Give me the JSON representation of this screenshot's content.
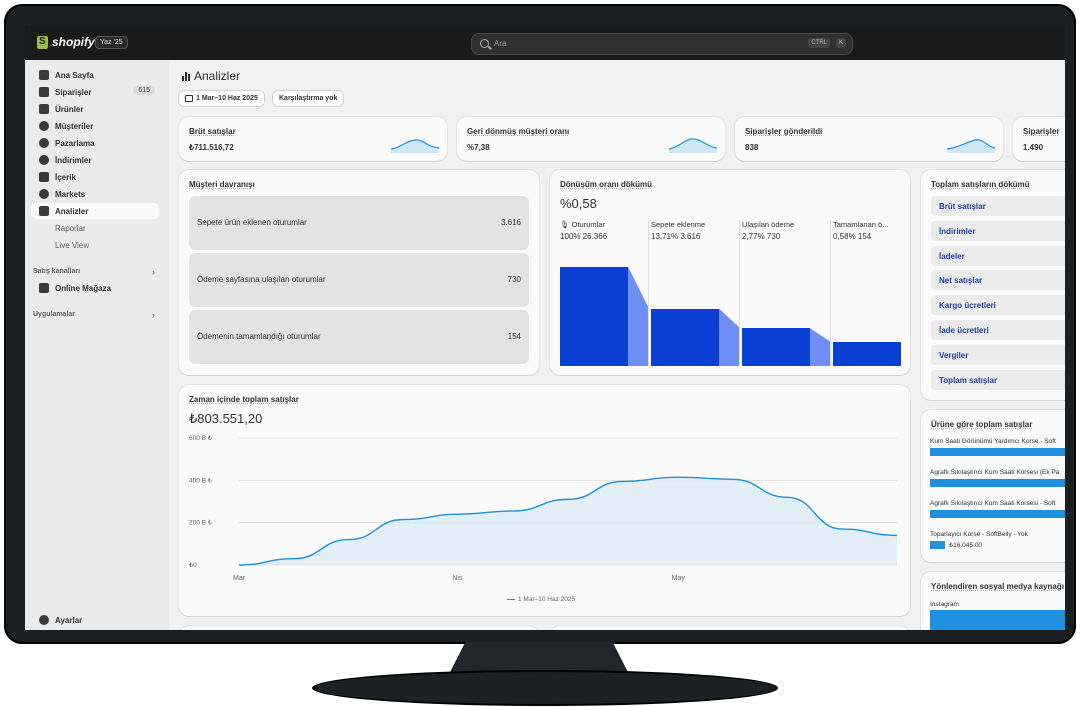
{
  "app": {
    "brand": "shopify",
    "edition_badge": "Yaz '25"
  },
  "search": {
    "placeholder": "Ara",
    "shortcut_ctrl": "CTRL",
    "shortcut_key": "K"
  },
  "sidebar": {
    "items": [
      {
        "label": "Ana Sayfa",
        "icon": "home-icon"
      },
      {
        "label": "Siparişler",
        "icon": "orders-icon",
        "count": "615"
      },
      {
        "label": "Ürünler",
        "icon": "tag-icon"
      },
      {
        "label": "Müşteriler",
        "icon": "person-icon"
      },
      {
        "label": "Pazarlama",
        "icon": "target-icon"
      },
      {
        "label": "İndirimler",
        "icon": "discount-icon"
      },
      {
        "label": "İçerik",
        "icon": "content-icon"
      },
      {
        "label": "Markets",
        "icon": "globe-icon"
      },
      {
        "label": "Analizler",
        "icon": "analytics-icon"
      }
    ],
    "subitems": [
      "Raporlar",
      "Live View"
    ],
    "sales_channels_heading": "Satış kanalları",
    "online_store": "Online Mağaza",
    "apps_heading": "Uygulamalar",
    "settings": "Ayarlar"
  },
  "page": {
    "title": "Analizler",
    "date_range": "1 Mar–10 Haz 2025",
    "comparison": "Karşılaştırma yok"
  },
  "metrics": [
    {
      "title": "Brüt satışlar",
      "value": "₺711.516,72"
    },
    {
      "title": "Geri dönmüş müşteri oranı",
      "value": "%7,38"
    },
    {
      "title": "Siparişler gönderildi",
      "value": "838"
    },
    {
      "title": "Siparişler",
      "value": "1.490"
    }
  ],
  "customer_behavior": {
    "title": "Müşteri davranışı",
    "rows": [
      {
        "label": "Sepete ürün eklenen oturumlar",
        "value": "3.616"
      },
      {
        "label": "Ödeme sayfasına ulaşılan oturumlar",
        "value": "730"
      },
      {
        "label": "Ödemenin tamamlandığı oturumlar",
        "value": "154"
      }
    ]
  },
  "conversion": {
    "title": "Dönüşüm oranı dökümü",
    "value": "%0,58",
    "steps": [
      {
        "label": "Oturumlar",
        "pct": "100%",
        "count": "26.366",
        "level": 0.71
      },
      {
        "label": "Sepete eklenme",
        "pct": "13,71%",
        "count": "3.616",
        "level": 0.41
      },
      {
        "label": "Ulaşılan ödeme",
        "pct": "2,77%",
        "count": "730",
        "level": 0.27
      },
      {
        "label": "Tamamlanan ö...",
        "pct": "0,58%",
        "count": "154",
        "level": 0.17
      }
    ]
  },
  "sales_breakdown": {
    "title": "Toplam satışların dökümü",
    "items": [
      "Brüt satışlar",
      "İndirimler",
      "İadeler",
      "Net satışlar",
      "Kargo ücretleri",
      "İade ücretleri",
      "Vergiler",
      "Toplam satışlar"
    ]
  },
  "sales_over_time": {
    "title": "Zaman içinde toplam satışlar",
    "value": "₺803.551,20",
    "legend": "1 Mar–10 Haz 2025"
  },
  "chart_data": {
    "type": "area",
    "title": "Zaman içinde toplam satışlar",
    "x": [
      "Mar",
      "",
      "",
      "",
      "Nis",
      "",
      "",
      "",
      "May",
      "",
      "",
      "",
      ""
    ],
    "x_ticks": [
      "Mar",
      "Nis",
      "May"
    ],
    "y_ticks": [
      "600 B ₺",
      "400 B ₺",
      "200 B ₺",
      "₺0"
    ],
    "ylim": [
      0,
      600000
    ],
    "series": [
      {
        "name": "1 Mar–10 Haz 2025",
        "values": [
          0,
          30000,
          120000,
          215000,
          240000,
          255000,
          310000,
          395000,
          415000,
          405000,
          320000,
          170000,
          140000
        ]
      }
    ],
    "grid": true,
    "legend_position": "bottom"
  },
  "product_sales": {
    "title": "Ürüne göre toplam satışlar",
    "items": [
      {
        "label": "Kum Saati Görünümü Yardımcı Korse - Soft",
        "fraction": 1.0
      },
      {
        "label": "Agraflı Sıkılaştırıcı Kum Saati Korsesi (Ek Pa",
        "fraction": 1.0
      },
      {
        "label": "Agraflı Sıkılaştırıcı Kum Saati Korsesi - Soft",
        "fraction": 1.0
      },
      {
        "label": "Toparlayıcı Korse - SoftBelly - Yok",
        "value": "₺16.045,00",
        "fraction": 0.1
      }
    ]
  },
  "social": {
    "title": "Yönlendiren sosyal medya kaynağı",
    "items": [
      {
        "label": "Instagram",
        "fraction": 1.0
      }
    ]
  },
  "colors": {
    "accent_blue": "#0a3fd4",
    "chart_line": "#1f8fe0",
    "topbar": "#1a1a1a"
  }
}
